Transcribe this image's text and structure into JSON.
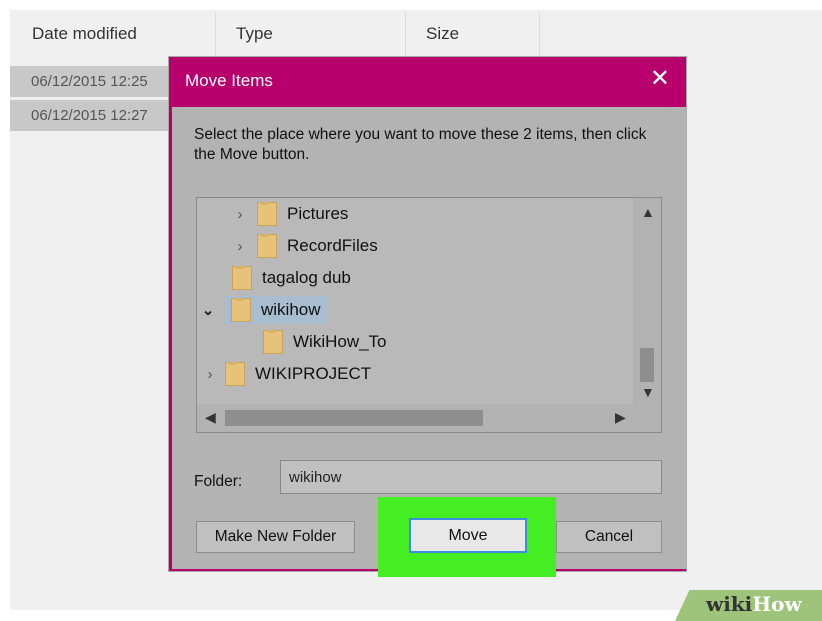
{
  "explorer": {
    "columns": [
      "Date modified",
      "Type",
      "Size"
    ],
    "rows": [
      "06/12/2015 12:25",
      "06/12/2015 12:27"
    ]
  },
  "dialog": {
    "title": "Move Items",
    "close_icon": "close-icon",
    "instruction": "Select the place where you want to move these 2 items, then click the Move button.",
    "tree": [
      {
        "label": "Pictures",
        "expander": ">"
      },
      {
        "label": "RecordFiles",
        "expander": ">"
      },
      {
        "label": "tagalog dub",
        "expander": ""
      },
      {
        "label": "wikihow",
        "expander": "v",
        "selected": true
      },
      {
        "label": "WikiHow_To",
        "expander": ""
      },
      {
        "label": "WIKIPROJECT",
        "expander": ">"
      }
    ],
    "folder_label": "Folder:",
    "folder_value": "wikihow",
    "buttons": {
      "make_new_folder": "Make New Folder",
      "move": "Move",
      "cancel": "Cancel"
    },
    "accent": "#b8006c"
  },
  "highlight_color": "#44ee22",
  "watermark": {
    "wiki": "wiki",
    "how": "How"
  }
}
